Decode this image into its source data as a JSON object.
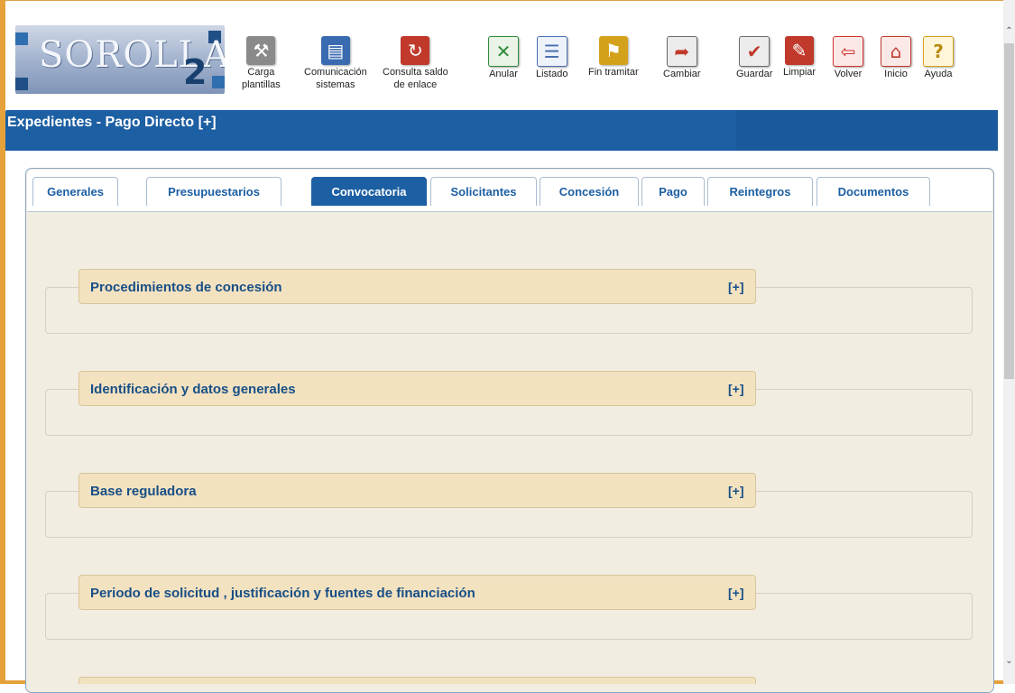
{
  "app": {
    "logo_text": "SOROLLA",
    "logo_number": "2"
  },
  "toolbar": [
    {
      "label_1": "Carga",
      "label_2": "plantillas",
      "icon": "wrench-icon",
      "color": "#7d7d7d"
    },
    {
      "label_1": "Comunicación",
      "label_2": "sistemas",
      "icon": "computer-icon",
      "color": "#3a6bb0"
    },
    {
      "label_1": "Consulta saldo",
      "label_2": "de enlace",
      "icon": "refresh-icon",
      "color": "#c0392b"
    },
    {
      "label_1": "Anular",
      "label_2": "",
      "icon": "cancel-icon",
      "color": "#2e8b3a"
    },
    {
      "label_1": "Listado",
      "label_2": "",
      "icon": "list-icon",
      "color": "#4a6fb0"
    },
    {
      "label_1": "Fin tramitar",
      "label_2": "",
      "icon": "finish-icon",
      "color": "#d4a21a"
    },
    {
      "label_1": "Cambiar",
      "label_2": "",
      "icon": "change-icon",
      "color": "#6b6b6b"
    },
    {
      "label_1": "Guardar",
      "label_2": "",
      "icon": "save-icon",
      "color": "#c0392b"
    },
    {
      "label_1": "Limpiar",
      "label_2": "",
      "icon": "eraser-icon",
      "color": "#c0392b"
    },
    {
      "label_1": "Volver",
      "label_2": "",
      "icon": "back-icon",
      "color": "#d0312d"
    },
    {
      "label_1": "Inicio",
      "label_2": "",
      "icon": "home-icon",
      "color": "#c0392b"
    },
    {
      "label_1": "Ayuda",
      "label_2": "",
      "icon": "help-icon",
      "color": "#d4a21a"
    }
  ],
  "header": {
    "title": "Expedientes - Pago Directo [+]"
  },
  "tabs": [
    {
      "label": "Generales",
      "active": false
    },
    {
      "label": "Presupuestarios",
      "active": false
    },
    {
      "label": "Convocatoria",
      "active": true
    },
    {
      "label": "Solicitantes",
      "active": false
    },
    {
      "label": "Concesión",
      "active": false
    },
    {
      "label": "Pago",
      "active": false
    },
    {
      "label": "Reintegros",
      "active": false
    },
    {
      "label": "Documentos",
      "active": false
    }
  ],
  "sections": [
    {
      "title": "Procedimientos de concesión",
      "toggle": "[+]"
    },
    {
      "title": "Identificación y datos generales",
      "toggle": "[+]"
    },
    {
      "title": "Base reguladora",
      "toggle": "[+]"
    },
    {
      "title": "Periodo de solicitud , justificación y fuentes de financiación",
      "toggle": "[+]"
    }
  ],
  "colors": {
    "accent": "#1d5fa3",
    "frame": "#e5a23a",
    "panel_bg": "#f2ede1",
    "legend_bg": "#f3e2c0"
  }
}
